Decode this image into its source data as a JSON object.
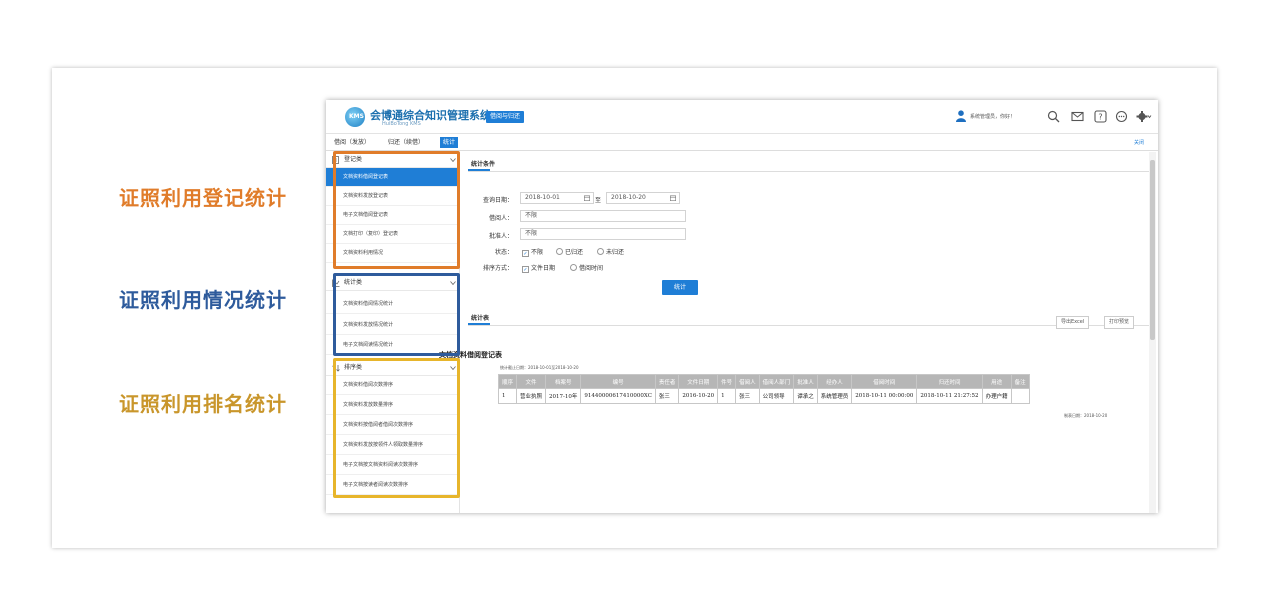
{
  "callouts": {
    "register": "证照利用登记统计",
    "usage": "证照利用情况统计",
    "ranking": "证照利用排名统计"
  },
  "colors": {
    "orange": "#e07c2a",
    "blue": "#2e5b9c",
    "gold": "#e7b52b",
    "accent": "#1f7ed6"
  },
  "app": {
    "title": "会博通综合知识管理系统",
    "subtitle": "HuiBoTong KMS",
    "top_pill": "借阅与归还",
    "user_greeting": "系统管理员，你好！",
    "top_icons": [
      "search-icon",
      "mail-icon",
      "help-icon",
      "chat-icon",
      "gear-icon"
    ]
  },
  "tabs": [
    {
      "label": "借阅（发放）"
    },
    {
      "label": "归还（续借）"
    },
    {
      "label": "统计"
    }
  ],
  "close_label": "关闭",
  "sidebar": {
    "groups": [
      {
        "title": "登记类",
        "icon": "edit-icon",
        "items": [
          "文档资料借阅登记表",
          "文档资料发放登记表",
          "电子文档借阅登记表",
          "文档打印（复印）登记表",
          "文档资料利用情况"
        ]
      },
      {
        "title": "统计类",
        "icon": "chart-icon",
        "items": [
          "文档资料借阅情况统计",
          "文档资料发放情况统计",
          "电子文档阅读情况统计"
        ]
      },
      {
        "title": "排序类",
        "icon": "sort-icon",
        "items": [
          "文档资料借阅次数排序",
          "文档资料发放数量排序",
          "文档资料按借阅者借阅次数排序",
          "文档资料发放按领件人领取数量排序",
          "电子文档按文档资料阅读次数排序",
          "电子文档按读者阅读次数排序"
        ]
      }
    ]
  },
  "conditions": {
    "section_title": "统计条件",
    "query_date_label": "查询日期：",
    "date_from": "2018-10-01",
    "date_to_label": "至",
    "date_to": "2018-10-20",
    "borrower_label": "借阅人：",
    "borrower_value": "不限",
    "approver_label": "批准人：",
    "approver_value": "不限",
    "status_label": "状态：",
    "status_options": [
      "不限",
      "已归还",
      "未归还"
    ],
    "sort_label": "排序方式：",
    "sort_options": [
      "文件日期",
      "借阅时间"
    ],
    "stat_button": "统计"
  },
  "report": {
    "section_title": "统计表",
    "export_button": "导出Excel",
    "print_button": "打印预览",
    "title": "文档资料借阅登记表",
    "range_note": "统计截止日期：2018-10-01至2018-10-20",
    "made_note": "制表日期：2018-10-20",
    "headers": [
      "顺序",
      "文件",
      "档案号",
      "编号",
      "责任者",
      "文件日期",
      "件号",
      "借阅人",
      "借阅人部门",
      "批准人",
      "经办人",
      "借阅时间",
      "归还时间",
      "用途",
      "备注"
    ],
    "rows": [
      [
        "1",
        "营业执照",
        "2017-10年",
        "91440000617410000XC",
        "张三",
        "2016-10-20",
        "1",
        "张三",
        "公司领导",
        "谭承之",
        "系统管理员",
        "2018-10-11 00:00:00",
        "2018-10-11 21:27:52",
        "办理户籍",
        ""
      ]
    ]
  }
}
